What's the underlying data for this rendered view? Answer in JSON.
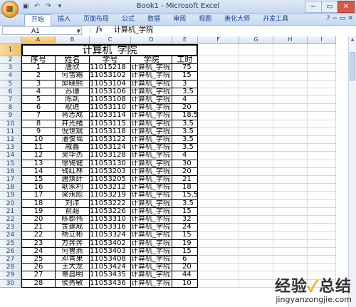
{
  "app": {
    "title": "Book1 - Microsoft Excel",
    "tabs": [
      "开始",
      "插入",
      "页面布局",
      "公式",
      "数据",
      "审阅",
      "视图",
      "美化大师",
      "开发工具"
    ],
    "active_tab": 0,
    "win_controls": [
      "−",
      "▭",
      "✕"
    ]
  },
  "formula_bar": {
    "name_box": "A1",
    "fx_label": "fx",
    "value": "计算机_学院"
  },
  "columns": [
    "A",
    "B",
    "C",
    "D",
    "E",
    "F",
    "G",
    "H",
    "I"
  ],
  "sheet": {
    "title": "计算机_学院",
    "headers": [
      "序号",
      "姓名",
      "学号",
      "学院",
      "工时"
    ],
    "rows": [
      [
        "1",
        "唐欣",
        "11015218",
        "计算机_学院",
        "75"
      ],
      [
        "2",
        "何雪霜",
        "11053102",
        "计算机_学院",
        "15"
      ],
      [
        "3",
        "邱晓熙",
        "11053104",
        "计算机_学院",
        "3"
      ],
      [
        "4",
        "苏珊",
        "11053106",
        "计算机_学院",
        "3.5"
      ],
      [
        "5",
        "陈凯",
        "11053108",
        "计算机_学院",
        "4"
      ],
      [
        "6",
        "耿进",
        "11053110",
        "计算机_学院",
        "20"
      ],
      [
        "7",
        "蒋志成",
        "11053114",
        "计算机_学院",
        "18.5"
      ],
      [
        "8",
        "井光绪",
        "11053115",
        "计算机_学院",
        "3.5"
      ],
      [
        "9",
        "倪世斌",
        "11053118",
        "计算机_学院",
        "3.5"
      ],
      [
        "10",
        "潘俊瑶",
        "11053122",
        "计算机_学院",
        "3.5"
      ],
      [
        "11",
        "戚鑫",
        "11053124",
        "计算机_学院",
        "3.5"
      ],
      [
        "12",
        "吴华杰",
        "11053128",
        "计算机_学院",
        "4"
      ],
      [
        "13",
        "徐锡健",
        "11053130",
        "计算机_学院",
        "30"
      ],
      [
        "14",
        "钱红林",
        "11053203",
        "计算机_学院",
        "20"
      ],
      [
        "15",
        "唐焕纤",
        "11053205",
        "计算机_学院",
        "21"
      ],
      [
        "16",
        "耿家利",
        "11053212",
        "计算机_学院",
        "18"
      ],
      [
        "17",
        "梁永彪",
        "11053219",
        "计算机_学院",
        "15.5"
      ],
      [
        "18",
        "刘洋",
        "11053222",
        "计算机_学院",
        "3.5"
      ],
      [
        "19",
        "俞超",
        "11053226",
        "计算机_学院",
        "15"
      ],
      [
        "20",
        "陈郡伟",
        "11053310",
        "计算机_学院",
        "32"
      ],
      [
        "21",
        "金建成",
        "11053316",
        "计算机_学院",
        "24"
      ],
      [
        "22",
        "杨立彬",
        "11053324",
        "计算机_学院",
        "15"
      ],
      [
        "23",
        "方奔奔",
        "11053402",
        "计算机_学院",
        "19"
      ],
      [
        "24",
        "何鲁燕",
        "11053403",
        "计算机_学院",
        "15"
      ],
      [
        "25",
        "邓青果",
        "11053408",
        "计算机_学院",
        "6"
      ],
      [
        "26",
        "王大龙",
        "11053424",
        "计算机_学院",
        "20"
      ],
      [
        "27",
        "覃昌明",
        "11053435",
        "计算机_学院",
        "44"
      ],
      [
        "28",
        "侯秀敏",
        "11053436",
        "计算机_学院",
        "10"
      ]
    ]
  },
  "watermark": {
    "main_a": "经验",
    "main_b": "总结",
    "url": "jingyanzongjie.com"
  }
}
